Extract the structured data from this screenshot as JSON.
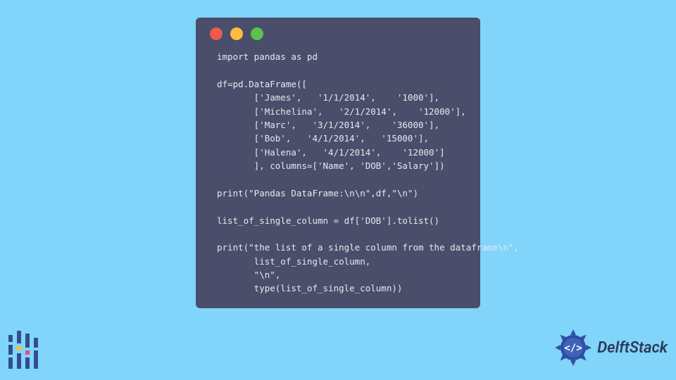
{
  "code": {
    "l01": "import pandas as pd",
    "l02": "",
    "l03": "df=pd.DataFrame([",
    "l04": "       ['James',   '1/1/2014',    '1000'],",
    "l05": "       ['Michelina',   '2/1/2014',    '12000'],",
    "l06": "       ['Marc',   '3/1/2014',    '36000'],",
    "l07": "       ['Bob',   '4/1/2014',   '15000'],",
    "l08": "       ['Halena',   '4/1/2014',    '12000']",
    "l09": "       ], columns=['Name', 'DOB','Salary'])",
    "l10": "",
    "l11": "print(\"Pandas DataFrame:\\n\\n\",df,\"\\n\")",
    "l12": "",
    "l13": "list_of_single_column = df['DOB'].tolist()",
    "l14": "",
    "l15": "print(\"the list of a single column from the dataframe\\n\",",
    "l16": "       list_of_single_column,",
    "l17": "       \"\\n\",",
    "l18": "       type(list_of_single_column))"
  },
  "brand": {
    "name": "DelftStack"
  },
  "colors": {
    "page_bg": "#81d4fa",
    "window_bg": "#4a4e6a",
    "code_fg": "#e8e8f0",
    "brand_fg": "#2b3a5b",
    "dot_red": "#ed594a",
    "dot_yellow": "#fdbc40",
    "dot_green": "#5bc14b"
  }
}
